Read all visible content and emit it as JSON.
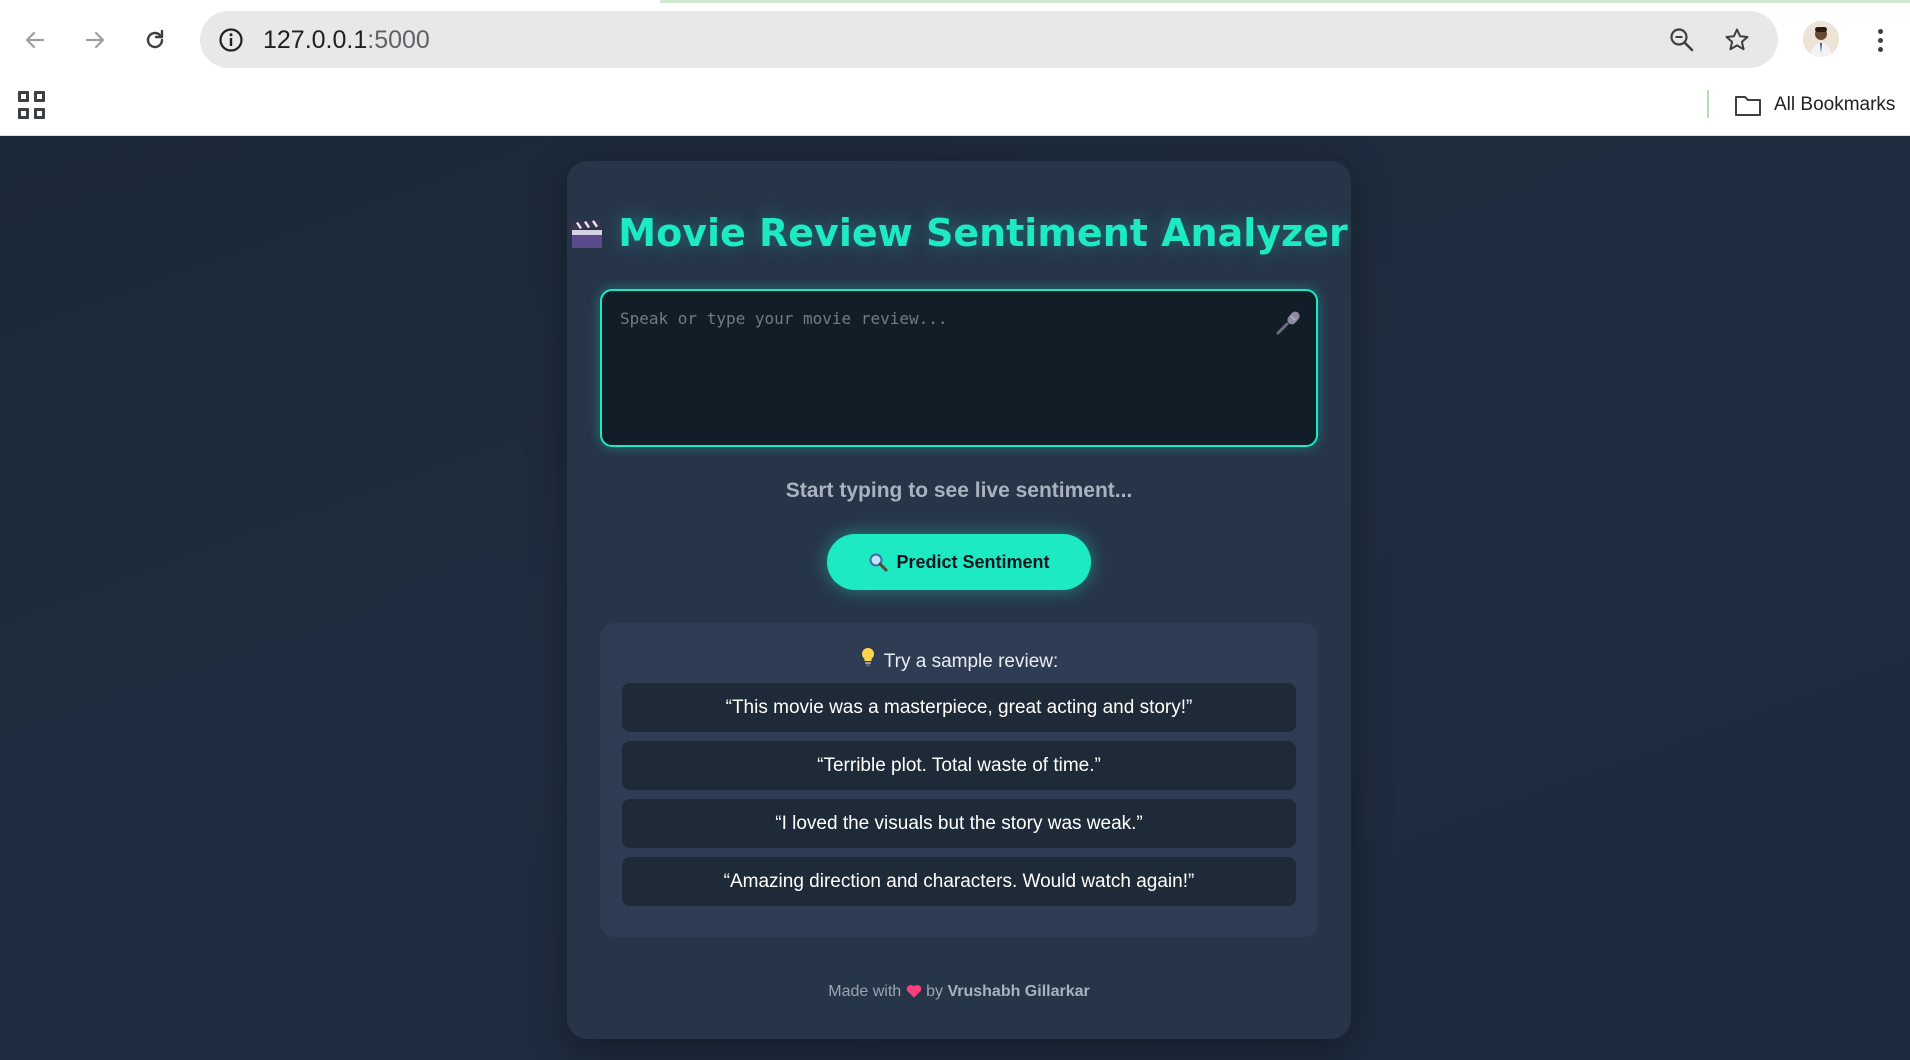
{
  "browser": {
    "url_host": "127.0.0.1",
    "url_port": ":5000",
    "bookmarks_label": "All Bookmarks"
  },
  "app": {
    "title": "Movie Review Sentiment Analyzer",
    "input_placeholder": "Speak or type your movie review...",
    "live_status": "Start typing to see live sentiment...",
    "predict_label": "Predict Sentiment",
    "samples_heading": "Try a sample review:",
    "samples": [
      "“This movie was a masterpiece, great acting and story!”",
      "“Terrible plot. Total waste of time.”",
      "“I loved the visuals but the story was weak.”",
      "“Amazing direction and characters. Would watch again!”"
    ],
    "footer_made_with": "Made with",
    "footer_by": "by",
    "footer_author": "Vrushabh Gillarkar"
  },
  "colors": {
    "accent": "#1de9c2",
    "card_bg": "#273549",
    "page_bg": "#1e2a3b"
  },
  "icons": [
    "back-arrow-icon",
    "forward-arrow-icon",
    "reload-icon",
    "info-icon",
    "zoom-icon",
    "star-icon",
    "apps-grid-icon",
    "folder-icon",
    "clapperboard-icon",
    "microphone-icon",
    "magnifier-icon",
    "lightbulb-icon",
    "heart-icon"
  ]
}
